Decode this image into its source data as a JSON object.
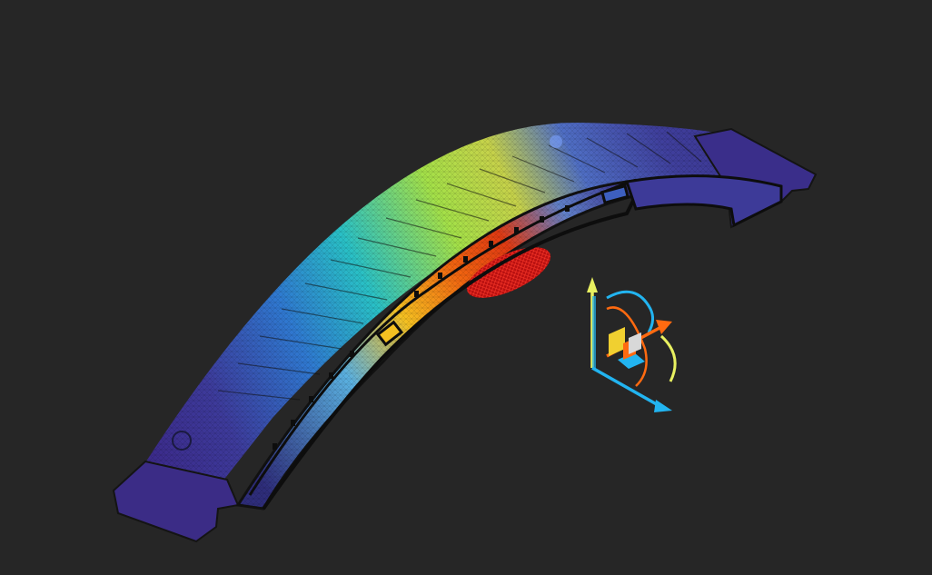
{
  "viewport": {
    "background": "#262626",
    "model": "curved-beam-mesh",
    "colormap": [
      "#3a2a8c",
      "#2f6fd0",
      "#27b6c9",
      "#9fe04a",
      "#f0c020",
      "#f06a10",
      "#d21010"
    ],
    "colormap_name": "rainbow-stress"
  },
  "gizmo": {
    "icon": "transform-gizmo-icon",
    "x_color": "#ff6a10",
    "y_color": "#e8f060",
    "z_color": "#22b4f0",
    "plane_color": "#d0d0d0"
  }
}
